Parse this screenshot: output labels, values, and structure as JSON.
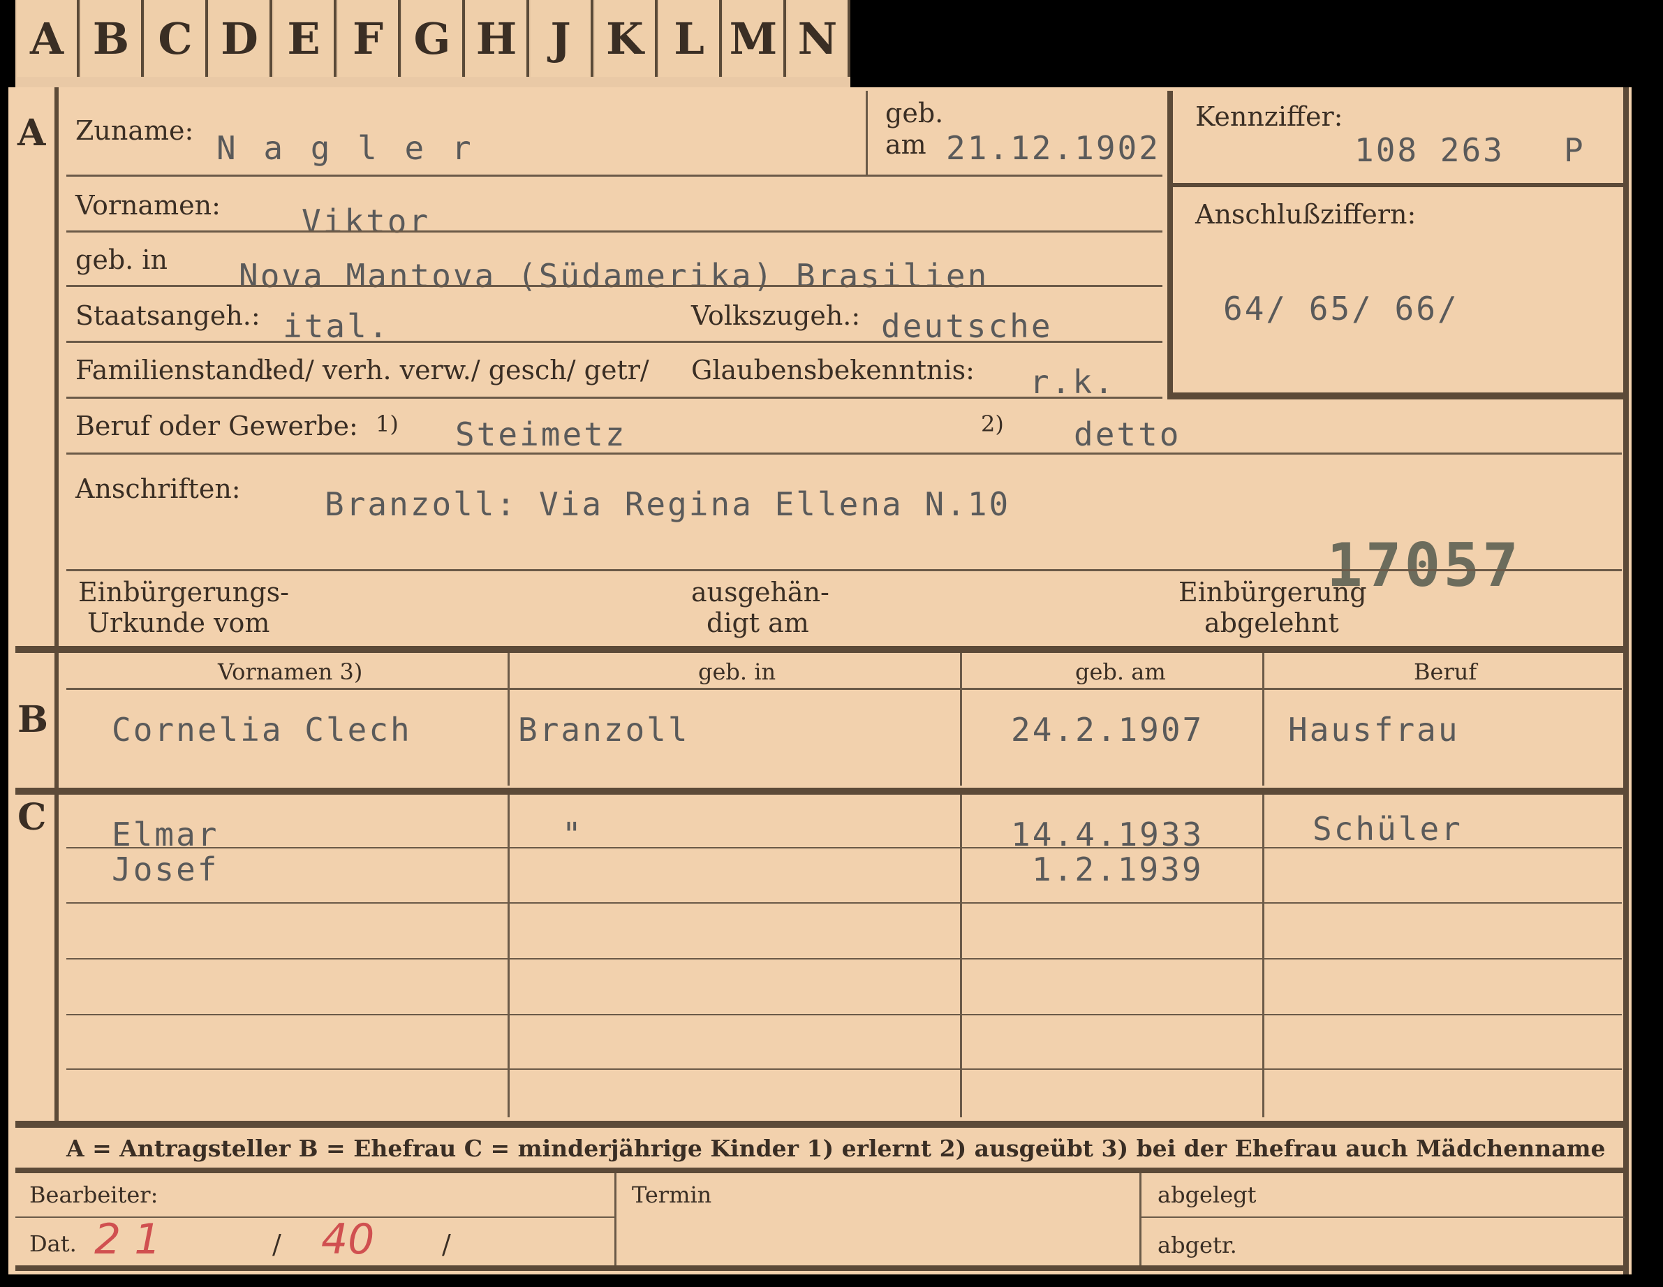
{
  "tabs": [
    "A",
    "B",
    "C",
    "D",
    "E",
    "F",
    "G",
    "H",
    "J",
    "K",
    "L",
    "M",
    "N"
  ],
  "section_a": {
    "marker": "A",
    "zuname_label": "Zuname:",
    "zuname": "N a g l e r",
    "geb_label": "geb.",
    "am_label": "am",
    "geb_am": "21.12.1902",
    "kennziffer_label": "Kennziffer:",
    "kennziffer": "108 263",
    "kennziffer_suffix": "P",
    "vornamen_label": "Vornamen:",
    "vornamen": "Viktor",
    "anschluss_label": "Anschlußziffern:",
    "anschluss": "64/ 65/ 66/",
    "geb_in_label": "geb. in",
    "geb_in": "Nova Mantova (Südamerika) Brasilien",
    "staatsangeh_label": "Staatsangeh.:",
    "staatsangeh": "ital.",
    "volkszugeh_label": "Volkszugeh.:",
    "volkszugeh": "deutsche",
    "familienstand_label": "Familienstand:",
    "familienstand_options": "led/ verh. verw./ gesch/ getr/",
    "glaubens_label": "Glaubensbekenntnis:",
    "glaubens": "r.k.",
    "beruf_label": "Beruf oder Gewerbe:",
    "beruf_1_marker": "1)",
    "beruf_1": "Steimetz",
    "beruf_2_marker": "2)",
    "beruf_2": "detto",
    "anschriften_label": "Anschriften:",
    "anschriften": "Branzoll: Via Regina Ellena N.10",
    "stamp_number": "17057",
    "einbuergerung_label_1": "Einbürgerungs-",
    "einbuergerung_label_2": "Urkunde vom",
    "ausgehaendigt_1": "ausgehän-",
    "ausgehaendigt_2": "digt am",
    "abgelehnt_1": "Einbürgerung",
    "abgelehnt_2": "abgelehnt"
  },
  "section_b": {
    "marker": "B",
    "headers": [
      "Vornamen 3)",
      "geb. in",
      "geb. am",
      "Beruf"
    ],
    "row": [
      "Cornelia Clech",
      "Branzoll",
      "24.2.1907",
      "Hausfrau"
    ]
  },
  "section_c": {
    "marker": "C",
    "rows": [
      [
        "Elmar",
        "\"",
        "14.4.1933",
        "Schüler"
      ],
      [
        "Josef",
        "",
        "1.2.1939",
        ""
      ]
    ]
  },
  "legend": "A = Antragsteller   B = Ehefrau   C = minderjährige Kinder   1) erlernt   2) ausgeübt   3) bei der Ehefrau auch Mädchenname",
  "footer": {
    "bearbeiter_label": "Bearbeiter:",
    "dat_label": "Dat.",
    "dat_day": "2 1",
    "dat_sep1": "/",
    "dat_year": "40",
    "dat_sep2": "/",
    "termin_label": "Termin",
    "abgelegt_label": "abgelegt",
    "abgetr_label": "abgetr."
  },
  "colors": {
    "card": "#f2d1ad",
    "ink": "#3a2e24",
    "typed": "#5a5a5a",
    "pencil_red": "#d05050"
  }
}
